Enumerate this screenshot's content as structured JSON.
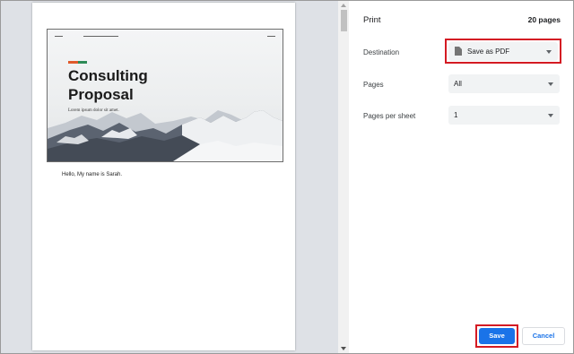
{
  "settings": {
    "title": "Print",
    "page_count": "20 pages",
    "destination": {
      "label": "Destination",
      "value": "Save as PDF"
    },
    "pages": {
      "label": "Pages",
      "value": "All"
    },
    "pages_per_sheet": {
      "label": "Pages per sheet",
      "value": "1"
    }
  },
  "buttons": {
    "save": "Save",
    "cancel": "Cancel"
  },
  "preview": {
    "hero_title_line1": "Consulting",
    "hero_title_line2": "Proposal",
    "hero_subtitle": "Lorem ipsum dolor sit amet.",
    "greeting": "Hello, My name is Sarah.",
    "accent_colors": [
      "#e05a2b",
      "#2e8b57"
    ]
  },
  "colors": {
    "accent_blue": "#1a73e8",
    "highlight_red": "#d41a23",
    "preview_bg": "#dee1e6"
  }
}
